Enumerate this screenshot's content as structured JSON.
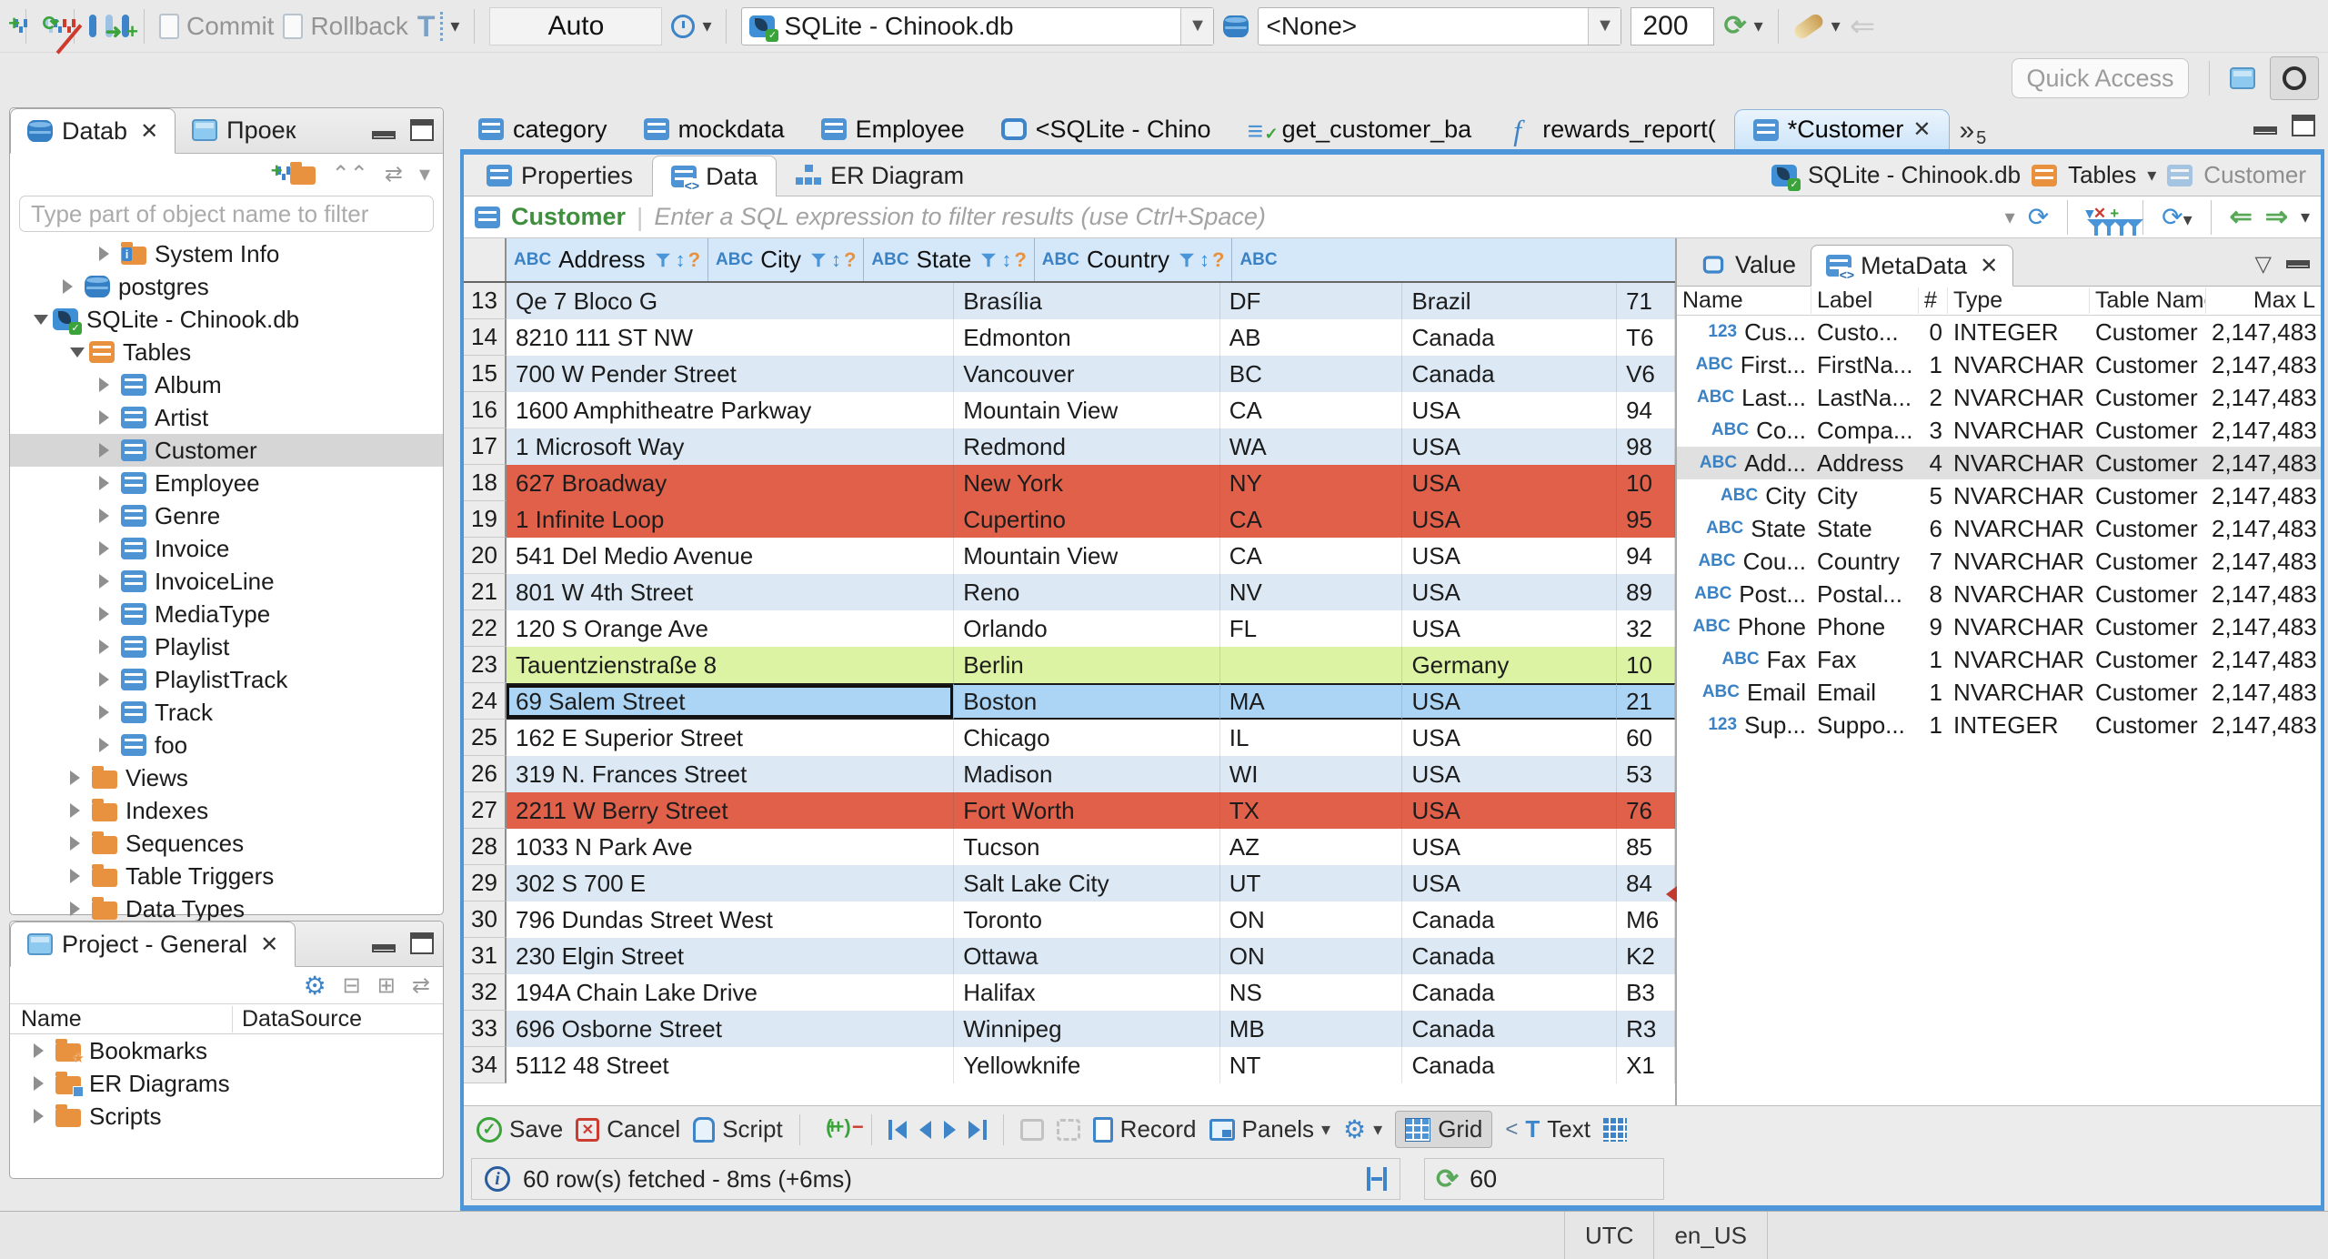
{
  "icons": {
    "chev": "▾",
    "close": "✕",
    "sort": "↕",
    "help": "?",
    "refresh": "⟳",
    "back": "⇐",
    "fwd": "⇒",
    "more": "»",
    "tri_down": "▽",
    "gear": "⚙",
    "check": "✓",
    "cross": "✕",
    "plus": "+",
    "minus": "−",
    "pipe": "|",
    "t": "T",
    "lt": "<"
  },
  "topbar": {
    "commit": "Commit",
    "rollback": "Rollback",
    "txn_mode": "Auto",
    "connection": "SQLite - Chinook.db",
    "schema": "<None>",
    "fetch_size": "200",
    "quick_access": "Quick Access"
  },
  "left_nav": {
    "tab_database": "Datab",
    "tab_projects": "Проек",
    "filter_placeholder": "Type part of object name to filter",
    "tree": [
      {
        "label": "System Info",
        "cls": "i3",
        "arrow": "collapsed",
        "icon": "folder info"
      },
      {
        "label": "postgres",
        "cls": "i1",
        "arrow": "collapsed",
        "icon": "db"
      },
      {
        "label": "SQLite - Chinook.db",
        "cls": "i0",
        "arrow": "expanded",
        "icon": "sqlite"
      },
      {
        "label": "Tables",
        "cls": "i2",
        "arrow": "expanded",
        "icon": "tfolder"
      },
      {
        "label": "Album",
        "cls": "i3",
        "arrow": "collapsed",
        "icon": "table"
      },
      {
        "label": "Artist",
        "cls": "i3",
        "arrow": "collapsed",
        "icon": "table"
      },
      {
        "label": "Customer",
        "cls": "i3 sel",
        "arrow": "collapsed",
        "icon": "table"
      },
      {
        "label": "Employee",
        "cls": "i3",
        "arrow": "collapsed",
        "icon": "table"
      },
      {
        "label": "Genre",
        "cls": "i3",
        "arrow": "collapsed",
        "icon": "table"
      },
      {
        "label": "Invoice",
        "cls": "i3",
        "arrow": "collapsed",
        "icon": "table"
      },
      {
        "label": "InvoiceLine",
        "cls": "i3",
        "arrow": "collapsed",
        "icon": "table"
      },
      {
        "label": "MediaType",
        "cls": "i3",
        "arrow": "collapsed",
        "icon": "table"
      },
      {
        "label": "Playlist",
        "cls": "i3",
        "arrow": "collapsed",
        "icon": "table"
      },
      {
        "label": "PlaylistTrack",
        "cls": "i3",
        "arrow": "collapsed",
        "icon": "table"
      },
      {
        "label": "Track",
        "cls": "i3",
        "arrow": "collapsed",
        "icon": "table"
      },
      {
        "label": "foo",
        "cls": "i3",
        "arrow": "collapsed",
        "icon": "table"
      },
      {
        "label": "Views",
        "cls": "i2",
        "arrow": "collapsed",
        "icon": "folder"
      },
      {
        "label": "Indexes",
        "cls": "i2",
        "arrow": "collapsed",
        "icon": "folder"
      },
      {
        "label": "Sequences",
        "cls": "i2",
        "arrow": "collapsed",
        "icon": "folder"
      },
      {
        "label": "Table Triggers",
        "cls": "i2",
        "arrow": "collapsed",
        "icon": "folder"
      },
      {
        "label": "Data Types",
        "cls": "i2",
        "arrow": "collapsed",
        "icon": "folder"
      }
    ]
  },
  "project_panel": {
    "title": "Project - General",
    "col_name": "Name",
    "col_datasource": "DataSource",
    "items": [
      {
        "label": "Bookmarks",
        "icon": "folder star"
      },
      {
        "label": "ER Diagrams",
        "icon": "folder er"
      },
      {
        "label": "Scripts",
        "icon": "folder"
      }
    ]
  },
  "editor": {
    "tabs": [
      {
        "label": "category",
        "icon": "table",
        "cls": ""
      },
      {
        "label": "mockdata",
        "icon": "table",
        "cls": ""
      },
      {
        "label": "Employee",
        "icon": "table",
        "cls": ""
      },
      {
        "label": "<SQLite - Chino",
        "icon": "sql",
        "cls": ""
      },
      {
        "label": "get_customer_ba",
        "icon": "sqlcheck",
        "cls": ""
      },
      {
        "label": "rewards_report(",
        "icon": "fx",
        "cls": ""
      },
      {
        "label": "*Customer",
        "icon": "table",
        "cls": "active"
      }
    ],
    "more_count": "5",
    "subtabs": [
      {
        "label": "Properties",
        "icon": "props",
        "cls": ""
      },
      {
        "label": "Data",
        "icon": "data",
        "cls": "active"
      },
      {
        "label": "ER Diagram",
        "icon": "er2",
        "cls": ""
      }
    ],
    "breadcrumb": {
      "connection": "SQLite - Chinook.db",
      "container": "Tables",
      "entity": "Customer"
    },
    "filter_table": "Customer",
    "filter_placeholder": "Enter a SQL expression to filter results (use Ctrl+Space)"
  },
  "grid": {
    "columns": [
      {
        "label": "Address",
        "type_icon": "ABC"
      },
      {
        "label": "City",
        "type_icon": "ABC"
      },
      {
        "label": "State",
        "type_icon": "ABC"
      },
      {
        "label": "Country",
        "type_icon": "ABC"
      }
    ],
    "partial_column_type_icon": "ABC",
    "rows": [
      {
        "n": "13",
        "address": "Qe 7 Bloco G",
        "city": "Brasília",
        "state": "DF",
        "country": "Brazil",
        "extra": "71",
        "cls": "stripe"
      },
      {
        "n": "14",
        "address": "8210 111 ST NW",
        "city": "Edmonton",
        "state": "AB",
        "country": "Canada",
        "extra": "T6",
        "cls": "plain"
      },
      {
        "n": "15",
        "address": "700 W Pender Street",
        "city": "Vancouver",
        "state": "BC",
        "country": "Canada",
        "extra": "V6",
        "cls": "stripe"
      },
      {
        "n": "16",
        "address": "1600 Amphitheatre Parkway",
        "city": "Mountain View",
        "state": "CA",
        "country": "USA",
        "extra": "94",
        "cls": "plain"
      },
      {
        "n": "17",
        "address": "1 Microsoft Way",
        "city": "Redmond",
        "state": "WA",
        "country": "USA",
        "extra": "98",
        "cls": "stripe"
      },
      {
        "n": "18",
        "address": "627 Broadway",
        "city": "New York",
        "state": "NY",
        "country": "USA",
        "extra": "10",
        "cls": "red"
      },
      {
        "n": "19",
        "address": "1 Infinite Loop",
        "city": "Cupertino",
        "state": "CA",
        "country": "USA",
        "extra": "95",
        "cls": "red"
      },
      {
        "n": "20",
        "address": "541 Del Medio Avenue",
        "city": "Mountain View",
        "state": "CA",
        "country": "USA",
        "extra": "94",
        "cls": "plain"
      },
      {
        "n": "21",
        "address": "801 W 4th Street",
        "city": "Reno",
        "state": "NV",
        "country": "USA",
        "extra": "89",
        "cls": "stripe"
      },
      {
        "n": "22",
        "address": "120 S Orange Ave",
        "city": "Orlando",
        "state": "FL",
        "country": "USA",
        "extra": "32",
        "cls": "plain"
      },
      {
        "n": "23",
        "address": "Tauentzienstraße 8",
        "city": "Berlin",
        "state": "",
        "country": "Germany",
        "extra": "10",
        "cls": "green"
      },
      {
        "n": "24",
        "address": "69 Salem Street",
        "city": "Boston",
        "state": "MA",
        "country": "USA",
        "extra": "21",
        "cls": "selected"
      },
      {
        "n": "25",
        "address": "162 E Superior Street",
        "city": "Chicago",
        "state": "IL",
        "country": "USA",
        "extra": "60",
        "cls": "plain"
      },
      {
        "n": "26",
        "address": "319 N. Frances Street",
        "city": "Madison",
        "state": "WI",
        "country": "USA",
        "extra": "53",
        "cls": "stripe"
      },
      {
        "n": "27",
        "address": "2211 W Berry Street",
        "city": "Fort Worth",
        "state": "TX",
        "country": "USA",
        "extra": "76",
        "cls": "red"
      },
      {
        "n": "28",
        "address": "1033 N Park Ave",
        "city": "Tucson",
        "state": "AZ",
        "country": "USA",
        "extra": "85",
        "cls": "plain"
      },
      {
        "n": "29",
        "address": "302 S 700 E",
        "city": "Salt Lake City",
        "state": "UT",
        "country": "USA",
        "extra": "84",
        "cls": "stripe"
      },
      {
        "n": "30",
        "address": "796 Dundas Street West",
        "city": "Toronto",
        "state": "ON",
        "country": "Canada",
        "extra": "M6",
        "cls": "plain"
      },
      {
        "n": "31",
        "address": "230 Elgin Street",
        "city": "Ottawa",
        "state": "ON",
        "country": "Canada",
        "extra": "K2",
        "cls": "stripe"
      },
      {
        "n": "32",
        "address": "194A Chain Lake Drive",
        "city": "Halifax",
        "state": "NS",
        "country": "Canada",
        "extra": "B3",
        "cls": "plain"
      },
      {
        "n": "33",
        "address": "696 Osborne Street",
        "city": "Winnipeg",
        "state": "MB",
        "country": "Canada",
        "extra": "R3",
        "cls": "stripe"
      },
      {
        "n": "34",
        "address": "5112 48 Street",
        "city": "Yellowknife",
        "state": "NT",
        "country": "Canada",
        "extra": "X1",
        "cls": "plain"
      }
    ]
  },
  "meta_panel": {
    "tab_value": "Value",
    "tab_metadata": "MetaData",
    "col_name": "Name",
    "col_label": "Label",
    "col_num": "#",
    "col_type": "Type",
    "col_table": "Table Name",
    "col_max": "Max L",
    "rows": [
      {
        "t": "123",
        "name": "Cus...",
        "label": "Custo...",
        "num": "0",
        "type": "INTEGER",
        "table": "Customer",
        "max": "2,147,483",
        "cls": ""
      },
      {
        "t": "ABC",
        "name": "First...",
        "label": "FirstNa...",
        "num": "1",
        "type": "NVARCHAR",
        "table": "Customer",
        "max": "2,147,483",
        "cls": ""
      },
      {
        "t": "ABC",
        "name": "Last...",
        "label": "LastNa...",
        "num": "2",
        "type": "NVARCHAR",
        "table": "Customer",
        "max": "2,147,483",
        "cls": ""
      },
      {
        "t": "ABC",
        "name": "Co...",
        "label": "Compa...",
        "num": "3",
        "type": "NVARCHAR",
        "table": "Customer",
        "max": "2,147,483",
        "cls": ""
      },
      {
        "t": "ABC",
        "name": "Add...",
        "label": "Address",
        "num": "4",
        "type": "NVARCHAR",
        "table": "Customer",
        "max": "2,147,483",
        "cls": "sel"
      },
      {
        "t": "ABC",
        "name": "City",
        "label": "City",
        "num": "5",
        "type": "NVARCHAR",
        "table": "Customer",
        "max": "2,147,483",
        "cls": ""
      },
      {
        "t": "ABC",
        "name": "State",
        "label": "State",
        "num": "6",
        "type": "NVARCHAR",
        "table": "Customer",
        "max": "2,147,483",
        "cls": ""
      },
      {
        "t": "ABC",
        "name": "Cou...",
        "label": "Country",
        "num": "7",
        "type": "NVARCHAR",
        "table": "Customer",
        "max": "2,147,483",
        "cls": ""
      },
      {
        "t": "ABC",
        "name": "Post...",
        "label": "Postal...",
        "num": "8",
        "type": "NVARCHAR",
        "table": "Customer",
        "max": "2,147,483",
        "cls": ""
      },
      {
        "t": "ABC",
        "name": "Phone",
        "label": "Phone",
        "num": "9",
        "type": "NVARCHAR",
        "table": "Customer",
        "max": "2,147,483",
        "cls": ""
      },
      {
        "t": "ABC",
        "name": "Fax",
        "label": "Fax",
        "num": "1",
        "type": "NVARCHAR",
        "table": "Customer",
        "max": "2,147,483",
        "cls": ""
      },
      {
        "t": "ABC",
        "name": "Email",
        "label": "Email",
        "num": "1",
        "type": "NVARCHAR",
        "table": "Customer",
        "max": "2,147,483",
        "cls": ""
      },
      {
        "t": "123",
        "name": "Sup...",
        "label": "Suppo...",
        "num": "1",
        "type": "INTEGER",
        "table": "Customer",
        "max": "2,147,483",
        "cls": ""
      }
    ]
  },
  "bottom": {
    "save": "Save",
    "cancel": "Cancel",
    "script": "Script",
    "record": "Record",
    "panels": "Panels",
    "grid": "Grid",
    "text": "Text",
    "status": "60 row(s) fetched - 8ms (+6ms)",
    "refresh_value": "60"
  },
  "statusbar": {
    "timezone": "UTC",
    "locale": "en_US"
  }
}
